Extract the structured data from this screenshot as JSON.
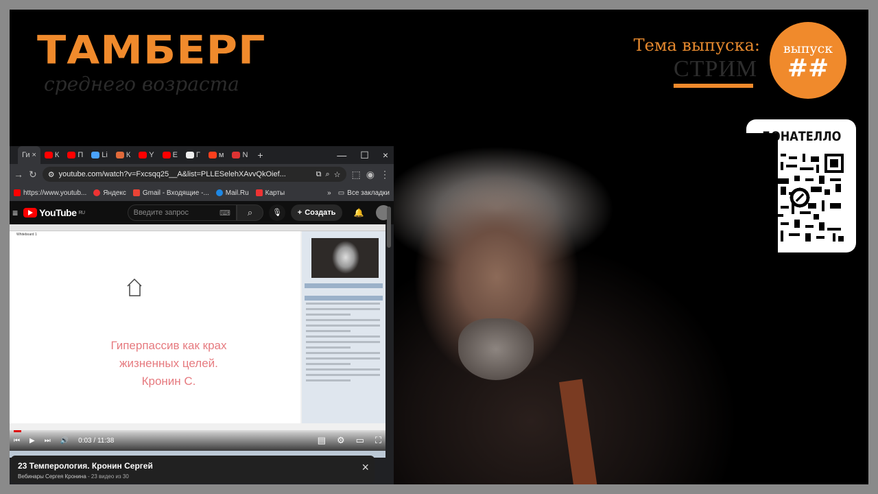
{
  "branding": {
    "title": "ТАМБЕРГ",
    "subtitle": "среднего возраста",
    "topic_label": "Тема выпуска:",
    "topic_value": "СТРИМ",
    "issue_label": "выпуск",
    "issue_number": "##",
    "accent_color": "#f08a2c"
  },
  "donate": {
    "title": "ДОНАТЕЛЛО"
  },
  "browser": {
    "tabs": [
      {
        "label": "Ги",
        "favicon": "youtube-icon",
        "active": true
      },
      {
        "label": "К",
        "favicon": "youtube-icon"
      },
      {
        "label": "П",
        "favicon": "youtube-icon"
      },
      {
        "label": "Li",
        "favicon": "bookmark-icon"
      },
      {
        "label": "К",
        "favicon": "flag-icon"
      },
      {
        "label": "Y",
        "favicon": "youtube-icon"
      },
      {
        "label": "E",
        "favicon": "youtube-icon"
      },
      {
        "label": "Г",
        "favicon": "wikipedia-icon"
      },
      {
        "label": "м",
        "favicon": "yandex-icon"
      },
      {
        "label": "N",
        "favicon": "calendar-icon"
      }
    ],
    "tab_close": "×",
    "new_tab": "+",
    "window_controls": {
      "minimize": "—",
      "maximize": "☐",
      "close": "×"
    },
    "url": "youtube.com/watch?v=Fxcsqq25__A&list=PLLESelehXAvvQkOief...",
    "bookmarks": [
      {
        "label": "https://www.youtub...",
        "color": "#ff0000"
      },
      {
        "label": "Яндекс",
        "color": "#e33"
      },
      {
        "label": "Gmail - Входящие -...",
        "color": "#ea4335"
      },
      {
        "label": "Mail.Ru",
        "color": "#1e88e5"
      },
      {
        "label": "Карты",
        "color": "#e33"
      }
    ],
    "bookmarks_overflow": "»",
    "all_bookmarks": "Все закладки"
  },
  "youtube": {
    "logo": "YouTube",
    "region": "RU",
    "search_placeholder": "Введите запрос",
    "create_label": "Создать",
    "time_current": "0:03",
    "time_total": "11:38",
    "progress_fraction": 0.004
  },
  "video_content": {
    "whiteboard_tab": "Whiteboard 1",
    "slide_line1": "Гиперпассив как крах",
    "slide_line2": "жизненных целей.",
    "slide_line3": "Кронин С."
  },
  "playlist": {
    "title": "23 Темперология. Кронин Сергей",
    "channel": "Вебинары Сергея Кронина",
    "position": "- 23 видео из 30"
  }
}
